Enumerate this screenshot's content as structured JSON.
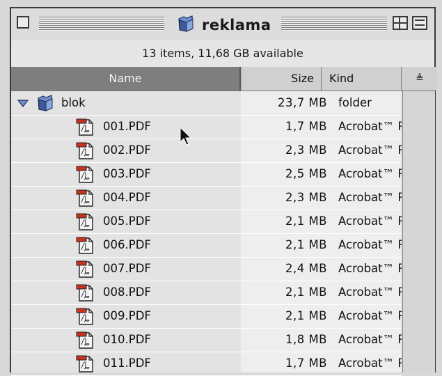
{
  "window": {
    "title": "reklama",
    "icon": "folder-icon"
  },
  "infobar": {
    "text": "13 items, 11,68 GB available"
  },
  "columns": {
    "name": "Name",
    "size": "Size",
    "kind": "Kind",
    "sort_indicator": "≜"
  },
  "folder": {
    "name": "blok",
    "size": "23,7 MB",
    "kind": "folder",
    "expanded": true
  },
  "files": [
    {
      "name": "001.PDF",
      "size": "1,7 MB",
      "kind": "Acrobat™ R"
    },
    {
      "name": "002.PDF",
      "size": "2,3 MB",
      "kind": "Acrobat™ R"
    },
    {
      "name": "003.PDF",
      "size": "2,5 MB",
      "kind": "Acrobat™ R"
    },
    {
      "name": "004.PDF",
      "size": "2,3 MB",
      "kind": "Acrobat™ R"
    },
    {
      "name": "005.PDF",
      "size": "2,1 MB",
      "kind": "Acrobat™ R"
    },
    {
      "name": "006.PDF",
      "size": "2,1 MB",
      "kind": "Acrobat™ R"
    },
    {
      "name": "007.PDF",
      "size": "2,4 MB",
      "kind": "Acrobat™ R"
    },
    {
      "name": "008.PDF",
      "size": "2,1 MB",
      "kind": "Acrobat™ R"
    },
    {
      "name": "009.PDF",
      "size": "2,1 MB",
      "kind": "Acrobat™ R"
    },
    {
      "name": "010.PDF",
      "size": "1,8 MB",
      "kind": "Acrobat™ R"
    },
    {
      "name": "011.PDF",
      "size": "1,7 MB",
      "kind": "Acrobat™ R"
    }
  ],
  "colors": {
    "selected_header": "#7e7e7e",
    "folder_blue": "#5a7ab8",
    "pdf_red": "#c8331f"
  }
}
